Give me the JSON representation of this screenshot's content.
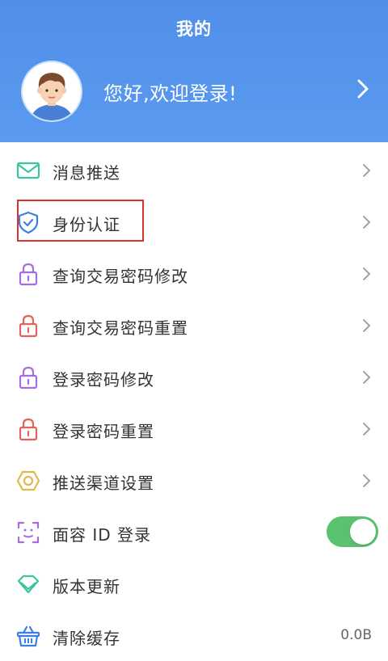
{
  "header": {
    "title": "我的",
    "greeting": "您好,欢迎登录!"
  },
  "menu": [
    {
      "label": "消息推送",
      "icon": "envelope-icon",
      "color": "#3cc3a0"
    },
    {
      "label": "身份认证",
      "icon": "shield-check-icon",
      "color": "#3b7ee8"
    },
    {
      "label": "查询交易密码修改",
      "icon": "lock-icon",
      "color": "#a46ee0"
    },
    {
      "label": "查询交易密码重置",
      "icon": "lock-icon",
      "color": "#e0645a"
    },
    {
      "label": "登录密码修改",
      "icon": "lock-icon",
      "color": "#a46ee0"
    },
    {
      "label": "登录密码重置",
      "icon": "lock-icon",
      "color": "#e0645a"
    },
    {
      "label": "推送渠道设置",
      "icon": "hexagon-icon",
      "color": "#e1b94a"
    },
    {
      "label": "面容 ID 登录",
      "icon": "face-id-icon",
      "color": "#a46ee0",
      "toggle_on": true
    },
    {
      "label": "版本更新",
      "icon": "diamond-icon",
      "color": "#3cc3a0"
    },
    {
      "label": "清除缓存",
      "icon": "basket-icon",
      "color": "#3b7ee8",
      "value": "0.0B"
    }
  ],
  "colors": {
    "header_bg": "#5b9af0",
    "toggle_on": "#5ac26f",
    "highlight": "#d9332d"
  }
}
